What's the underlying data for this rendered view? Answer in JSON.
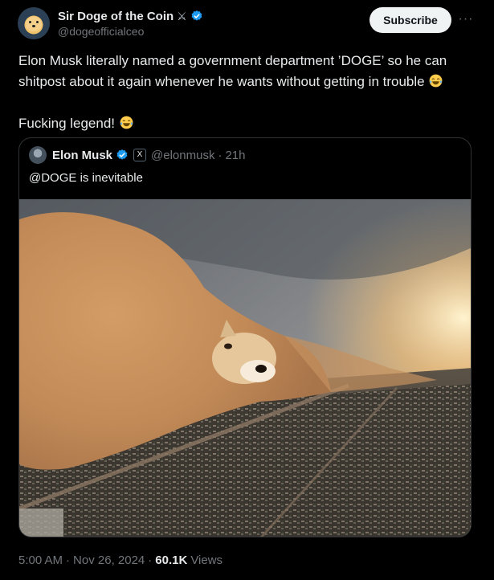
{
  "author": {
    "display_name": "Sir Doge of the Coin",
    "name_icon": "crossed-swords",
    "handle": "@dogeofficialceo",
    "verified": true,
    "verified_color": "#1d9bf0"
  },
  "actions": {
    "subscribe_label": "Subscribe",
    "more_label": "···"
  },
  "tweet": {
    "line1": "Elon Musk literally named a government department ’DOGE’ so he can shitpost about it again whenever he wants without getting in trouble",
    "line2": "Fucking legend!",
    "emoji": "face-with-tears-of-joy"
  },
  "quote": {
    "display_name": "Elon Musk",
    "verified": true,
    "x_badge": "X",
    "handle": "@elonmusk",
    "separator": "·",
    "time": "21h",
    "text": "@DOGE is inevitable",
    "image": "doge-face-dust-storm-over-city"
  },
  "footer": {
    "time": "5:00 AM",
    "sep1": "·",
    "date": "Nov 26, 2024",
    "sep2": "·",
    "views_count": "60.1K",
    "views_label": "Views"
  }
}
